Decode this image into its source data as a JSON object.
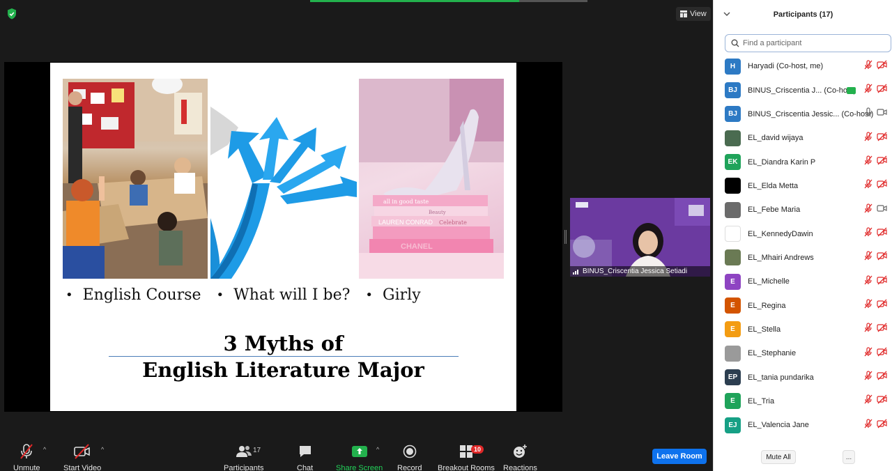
{
  "meeting": {
    "view_label": "View",
    "speaker_name": "BINUS_Criscentia Jessica Setiadi"
  },
  "slide": {
    "bullets": [
      "English Course",
      "What will I be?",
      "Girly"
    ],
    "title_line1": "3 Myths of",
    "title_line2": "English Literature Major"
  },
  "toolbar": {
    "unmute_label": "Unmute",
    "start_video_label": "Start Video",
    "participants_label": "Participants",
    "participants_count": "17",
    "chat_label": "Chat",
    "share_screen_label": "Share Screen",
    "record_label": "Record",
    "breakout_label": "Breakout Rooms",
    "breakout_count": "10",
    "reactions_label": "Reactions",
    "leave_label": "Leave Room"
  },
  "panel": {
    "title": "Participants (17)",
    "search_placeholder": "Find a participant",
    "mute_all_label": "Mute All",
    "more_label": "...",
    "participants": [
      {
        "initials": "H",
        "name": "Haryadi (Co-host, me)",
        "color": "#2d7ac4",
        "mic": "muted",
        "cam": "off"
      },
      {
        "initials": "BJ",
        "name": "BINUS_Criscentia J... (Co-host)",
        "color": "#2d7ac4",
        "mic": "muted",
        "cam": "off",
        "sharing": true
      },
      {
        "initials": "BJ",
        "name": "BINUS_Criscentia Jessic... (Co-host)",
        "color": "#2d7ac4",
        "mic": "on",
        "cam": "on"
      },
      {
        "initials": "",
        "name": "EL_david wijaya",
        "color": "#4a6b50",
        "mic": "muted",
        "cam": "off"
      },
      {
        "initials": "EK",
        "name": "EL_Diandra Karin P",
        "color": "#1fa35a",
        "mic": "muted",
        "cam": "off"
      },
      {
        "initials": "",
        "name": "EL_Elda Metta",
        "color": "#000000",
        "mic": "muted",
        "cam": "off"
      },
      {
        "initials": "",
        "name": "EL_Febe Maria",
        "color": "#6b6b6b",
        "mic": "muted",
        "cam": "on"
      },
      {
        "initials": "",
        "name": "EL_KennedyDawin",
        "color": "#ffffff",
        "mic": "muted",
        "cam": "off"
      },
      {
        "initials": "",
        "name": "EL_Mhairi Andrews",
        "color": "#6a7a54",
        "mic": "muted",
        "cam": "off"
      },
      {
        "initials": "E",
        "name": "EL_Michelle",
        "color": "#8e44c2",
        "mic": "muted",
        "cam": "off"
      },
      {
        "initials": "E",
        "name": "EL_Regina",
        "color": "#d35400",
        "mic": "muted",
        "cam": "off"
      },
      {
        "initials": "E",
        "name": "EL_Stella",
        "color": "#f39c12",
        "mic": "muted",
        "cam": "off"
      },
      {
        "initials": "",
        "name": "EL_Stephanie",
        "color": "#9a9a9a",
        "mic": "muted",
        "cam": "off"
      },
      {
        "initials": "EP",
        "name": "EL_tania pundarika",
        "color": "#2c3e50",
        "mic": "muted",
        "cam": "off"
      },
      {
        "initials": "E",
        "name": "EL_Tria",
        "color": "#1fa35a",
        "mic": "muted",
        "cam": "off"
      },
      {
        "initials": "EJ",
        "name": "EL_Valencia Jane",
        "color": "#16a085",
        "mic": "muted",
        "cam": "off"
      }
    ]
  }
}
